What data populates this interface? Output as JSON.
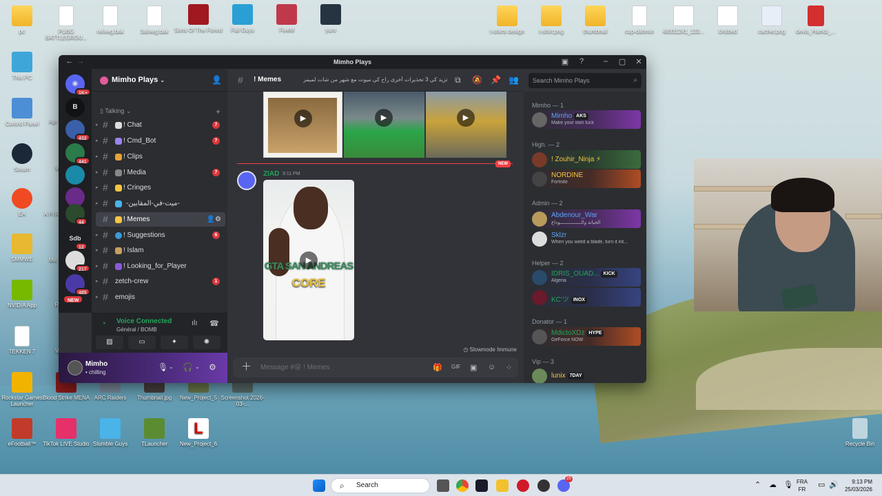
{
  "desktop_icons": [
    {
      "label": "pc",
      "icon": "folder-icon"
    },
    {
      "label": "PUBG BATTLEGROU...",
      "icon": "doc-icon"
    },
    {
      "label": "reliveg.bak",
      "icon": "doc-icon"
    },
    {
      "label": "3aliveg.bak",
      "icon": "doc-icon"
    },
    {
      "label": "Sons Of The Forest",
      "icon": "game-icon"
    },
    {
      "label": "Fall Guys",
      "icon": "game-icon"
    },
    {
      "label": "FiveM",
      "icon": "game-icon"
    },
    {
      "label": "yuro",
      "icon": "image-icon"
    },
    {
      "label": "t-shirts design",
      "icon": "folder-icon"
    },
    {
      "label": "t-shirt.png",
      "icon": "image-icon"
    },
    {
      "label": "thumbnail",
      "icon": "folder-icon"
    },
    {
      "label": "cup-dahmin",
      "icon": "doc-icon"
    },
    {
      "label": "48331241_133...",
      "icon": "image-icon"
    },
    {
      "label": "Untitled",
      "icon": "image-icon"
    },
    {
      "label": "cachet.png",
      "icon": "image-icon"
    },
    {
      "label": "devis_Hamdi_...",
      "icon": "pdf-icon"
    },
    {
      "label": "This PC",
      "icon": "monitor-icon"
    },
    {
      "label": "Control Panel",
      "icon": "control-panel-icon"
    },
    {
      "label": "Steam",
      "icon": "steam-icon"
    },
    {
      "label": "EA",
      "icon": "ea-icon"
    },
    {
      "label": "SMMWE",
      "icon": "game-icon"
    },
    {
      "label": "NVIDIA App",
      "icon": "nvidia-icon"
    },
    {
      "label": "TEKKEN 7",
      "icon": "doc-icon"
    },
    {
      "label": "Rockstar Games Launcher",
      "icon": "rockstar-icon"
    },
    {
      "label": "eFootball™",
      "icon": "game-icon"
    },
    {
      "label": "Blood Strike MENA",
      "icon": "game-icon"
    },
    {
      "label": "ARC Raiders",
      "icon": "game-icon"
    },
    {
      "label": "Thumbnail.jpg",
      "icon": "image-icon"
    },
    {
      "label": "New_Project_5",
      "icon": "image-icon"
    },
    {
      "label": "Screenshot 2026-03-...",
      "icon": "image-icon"
    },
    {
      "label": "TikTok LIVE Studio",
      "icon": "tiktok-icon"
    },
    {
      "label": "Stumble Guys",
      "icon": "game-icon"
    },
    {
      "label": "TLauncher",
      "icon": "minecraft-icon"
    },
    {
      "label": "New_Project_6",
      "icon": "image-icon"
    },
    {
      "label": "Recycle Bin",
      "icon": "recycle-bin-icon"
    }
  ],
  "partial_labels": [
    "Apr",
    "VA",
    "A Pi Ro",
    "Mic",
    "RA",
    "VA"
  ],
  "discord": {
    "window_title": "Mimho Plays",
    "server_name": "Mimho Plays",
    "guild_badges": [
      "1K+",
      "B",
      "432",
      "441",
      "",
      "",
      "44",
      "12",
      "217",
      "485",
      "NEW"
    ],
    "guild_labels": [
      "Sdb"
    ],
    "category": "Talking",
    "channels": [
      {
        "name": "! Chat",
        "badge": "7"
      },
      {
        "name": "! Cmd_Bot",
        "badge": "7"
      },
      {
        "name": "! Clips",
        "badge": ""
      },
      {
        "name": "! Media",
        "badge": "7"
      },
      {
        "name": "! Cringes",
        "badge": ""
      },
      {
        "name": "-ميت-في-المقابين-",
        "badge": ""
      },
      {
        "name": "! Memes",
        "badge": ""
      },
      {
        "name": "! Suggestions",
        "badge": "6"
      },
      {
        "name": "! Islam",
        "badge": ""
      },
      {
        "name": "! Looking_for_Player",
        "badge": ""
      },
      {
        "name": "zetch-crew",
        "badge": "1"
      },
      {
        "name": "emojis",
        "badge": ""
      }
    ],
    "voice": {
      "status": "Voice Connected",
      "channel": "Général / BOMB"
    },
    "user": {
      "name": "Mimho",
      "status": "chilling"
    },
    "chat": {
      "channel": "! Memes",
      "topic": "او تزيد كي 3 تحذيرات أخرى راح كي ميوت مع شهر من شات لميمز",
      "new_label": "NEW",
      "message": {
        "author": "ZIAD",
        "time": "9:11 PM",
        "gif_text_1": "GTA SAN ANDREAS",
        "gif_text_2": "CORE"
      },
      "slowmode": "Slowmode Immune",
      "placeholder": "Message #😜 ! Memes"
    },
    "search_placeholder": "Search Mimho Plays",
    "member_groups": [
      {
        "title": "Mimho — 1",
        "members": [
          {
            "name": "Mimho",
            "tag": "AKS",
            "status": "Make your own luck",
            "color": "#5ea2f5"
          }
        ]
      },
      {
        "title": "High. — 2",
        "members": [
          {
            "name": "! Zouhir_Ninja ⚡",
            "tag": "",
            "status": "",
            "color": "#f5c542"
          },
          {
            "name": "NORDINE",
            "tag": "",
            "status": "Fortnite",
            "color": "#f5c542"
          }
        ]
      },
      {
        "title": "Admin — 2",
        "members": [
          {
            "name": "Abdenour_War",
            "tag": "",
            "status": "الخيانة والـــــــــــــــوداع",
            "color": "#5ea2f5"
          },
          {
            "name": "Sklzr",
            "tag": "",
            "status": "When you wield a blade, turn it int...",
            "color": "#5ea2f5"
          }
        ]
      },
      {
        "title": "Helper — 2",
        "members": [
          {
            "name": "IDRIS_OUAD...",
            "tag": "KICK",
            "status": "Algeria",
            "color": "#23a55a"
          },
          {
            "name": "KC'ツ",
            "tag": "INOX",
            "status": "",
            "color": "#23a55a"
          }
        ]
      },
      {
        "title": "Donator — 1",
        "members": [
          {
            "name": "MdictoXDz",
            "tag": "HYPE",
            "status": "GeForce NOW",
            "color": "#23a55a"
          }
        ]
      },
      {
        "title": "Vip — 3",
        "members": [
          {
            "name": "lunix",
            "tag": "7DAY",
            "status": "",
            "color": "#f5c542"
          }
        ]
      }
    ]
  },
  "taskbar": {
    "search_label": "Search",
    "discord_badge": "25",
    "lang_1": "FRA",
    "lang_2": "FR",
    "time": "9:13 PM",
    "date": "25/03/2026"
  }
}
